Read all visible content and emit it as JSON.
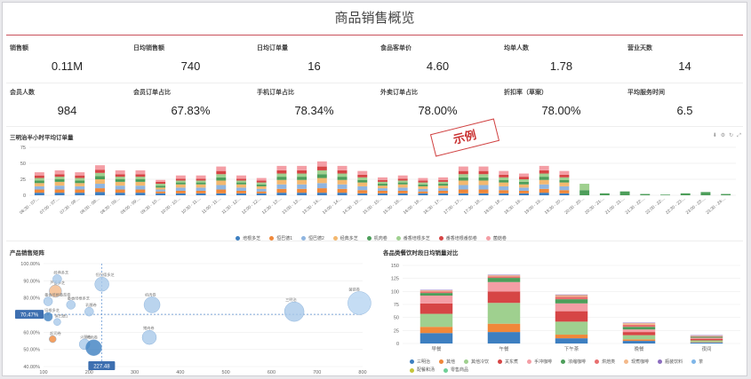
{
  "page_title": "商品销售概览",
  "stamp_text": "示例",
  "kpis": [
    {
      "label": "销售额",
      "value": "0.11M"
    },
    {
      "label": "日均销售额",
      "value": "740"
    },
    {
      "label": "日均订单量",
      "value": "16"
    },
    {
      "label": "食品客单价",
      "value": "4.60"
    },
    {
      "label": "均单人数",
      "value": "1.78"
    },
    {
      "label": "营业天数",
      "value": "14"
    },
    {
      "label": "会员人数",
      "value": "984"
    },
    {
      "label": "会员订单占比",
      "value": "67.83%"
    },
    {
      "label": "手机订单占比",
      "value": "78.34%"
    },
    {
      "label": "外卖订单占比",
      "value": "78.00%"
    },
    {
      "label": "折扣率（草案）",
      "value": "78.00%"
    },
    {
      "label": "平均服务时间",
      "value": "6.5"
    }
  ],
  "chart_icons": [
    "download-icon",
    "settings-icon",
    "refresh-icon",
    "expand-icon"
  ],
  "chart_data": [
    {
      "type": "bar",
      "title": "三明治半小时平均订单量",
      "ylim": [
        0,
        75
      ],
      "yticks": [
        0,
        25,
        50,
        75
      ],
      "grid": true,
      "legend_position": "bottom",
      "categories": [
        "06:30 - 07:...",
        "07:00 - 07:...",
        "07:30 - 08:...",
        "08:00 - 08:...",
        "08:30 - 09:...",
        "09:00 - 09:...",
        "09:30 - 10:...",
        "10:00 - 10:...",
        "10:30 - 11:...",
        "11:00 - 11:...",
        "11:30 - 12:...",
        "12:00 - 12:...",
        "12:30 - 13:...",
        "13:00 - 13:...",
        "13:30 - 14:...",
        "14:00 - 14:...",
        "14:30 - 15:...",
        "15:00 - 15:...",
        "15:30 - 16:...",
        "16:00 - 16:...",
        "16:30 - 17:...",
        "17:00 - 17:...",
        "17:30 - 18:...",
        "18:00 - 18:...",
        "18:30 - 19:...",
        "19:00 - 19:...",
        "19:30 - 20:...",
        "20:00 - 20:...",
        "20:30 - 21:...",
        "21:00 - 21:...",
        "21:30 - 22:...",
        "22:00 - 22:...",
        "22:30 - 23:...",
        "23:00 - 23:...",
        "23:30 - 24:..."
      ],
      "series": [
        {
          "name": "培根多芝",
          "color": "#3d7fc1",
          "values": [
            4,
            4,
            4,
            5,
            4,
            4,
            3,
            3,
            3,
            3,
            3,
            3,
            4,
            4,
            4,
            4,
            3,
            3,
            3,
            3,
            3,
            3,
            3,
            3,
            3,
            4,
            3,
            0,
            0,
            0,
            0,
            0,
            0,
            0,
            0
          ]
        },
        {
          "name": "恒巴德1",
          "color": "#f0883a",
          "values": [
            5,
            5,
            5,
            6,
            5,
            5,
            3,
            4,
            4,
            6,
            4,
            3,
            6,
            6,
            7,
            6,
            5,
            4,
            4,
            3,
            4,
            6,
            6,
            5,
            4,
            6,
            5,
            0,
            0,
            0,
            0,
            0,
            0,
            0,
            0
          ]
        },
        {
          "name": "恒巴德2",
          "color": "#8fb5e0",
          "values": [
            5,
            6,
            5,
            7,
            6,
            6,
            3,
            5,
            5,
            7,
            5,
            4,
            7,
            7,
            8,
            7,
            6,
            4,
            5,
            4,
            4,
            7,
            7,
            6,
            5,
            7,
            6,
            0,
            0,
            0,
            0,
            0,
            0,
            0,
            0
          ]
        },
        {
          "name": "经典多芝",
          "color": "#f3b86f",
          "values": [
            5,
            6,
            5,
            7,
            6,
            6,
            3,
            5,
            5,
            7,
            5,
            4,
            7,
            7,
            8,
            7,
            6,
            4,
            5,
            4,
            4,
            7,
            7,
            6,
            5,
            7,
            6,
            0,
            0,
            0,
            0,
            0,
            0,
            0,
            0
          ]
        },
        {
          "name": "机肉卷",
          "color": "#4d9e5a",
          "values": [
            4,
            4,
            4,
            5,
            4,
            4,
            3,
            3,
            3,
            5,
            3,
            3,
            5,
            5,
            6,
            5,
            4,
            3,
            3,
            3,
            3,
            5,
            5,
            4,
            4,
            5,
            4,
            8,
            3,
            6,
            2,
            1,
            3,
            5,
            2
          ]
        },
        {
          "name": "番香培根多芝",
          "color": "#9fd08f",
          "values": [
            4,
            4,
            4,
            5,
            4,
            4,
            3,
            3,
            3,
            5,
            3,
            3,
            5,
            5,
            6,
            5,
            4,
            3,
            3,
            3,
            3,
            5,
            5,
            4,
            4,
            5,
            4,
            10,
            0,
            0,
            0,
            0,
            0,
            0,
            0
          ]
        },
        {
          "name": "番香培根番茄卷",
          "color": "#d64545",
          "values": [
            4,
            4,
            4,
            5,
            4,
            4,
            3,
            3,
            3,
            5,
            3,
            3,
            5,
            5,
            6,
            5,
            4,
            3,
            3,
            3,
            3,
            5,
            5,
            4,
            4,
            5,
            4,
            0,
            0,
            0,
            0,
            0,
            0,
            0,
            0
          ]
        },
        {
          "name": "菌菇卷",
          "color": "#f49ea5",
          "values": [
            5,
            6,
            5,
            7,
            6,
            6,
            3,
            5,
            5,
            7,
            5,
            4,
            7,
            7,
            8,
            7,
            6,
            4,
            5,
            4,
            4,
            7,
            7,
            6,
            5,
            7,
            6,
            0,
            0,
            0,
            0,
            0,
            0,
            0,
            0
          ]
        }
      ]
    },
    {
      "type": "scatter",
      "title": "产品销售矩阵",
      "xlim": [
        100,
        800
      ],
      "ylim": [
        40,
        100
      ],
      "xticks": [
        100,
        200,
        300,
        400,
        500,
        600,
        700,
        800
      ],
      "yticks": [
        "40.00%",
        "50.00%",
        "60.00%",
        "70.00%",
        "80.00%",
        "90.00%",
        "100.00%"
      ],
      "ref_x_label": "227.48",
      "ref_y_label": "70.47%",
      "points": [
        {
          "label": "芦荟多芝",
          "x": 126,
          "y": 84,
          "r": 7,
          "color": "#f3b98a"
        },
        {
          "label": "恒巴德多芝",
          "x": 228,
          "y": 88,
          "r": 8,
          "color": "#a9c9ea"
        },
        {
          "label": "经典多芝",
          "x": 130,
          "y": 91,
          "r": 5,
          "color": "#a9c9ea"
        },
        {
          "label": "番香培根番茄卷",
          "x": 110,
          "y": 78,
          "r": 5,
          "color": "#a9c9ea"
        },
        {
          "label": "番香培根多芝",
          "x": 160,
          "y": 76,
          "r": 5,
          "color": "#a9c9ea"
        },
        {
          "label": "乳酪卷",
          "x": 200,
          "y": 72,
          "r": 5,
          "color": "#a9c9ea"
        },
        {
          "label": "机肉卷",
          "x": 338,
          "y": 76,
          "r": 9,
          "color": "#a9c9ea"
        },
        {
          "label": "三明治",
          "x": 650,
          "y": 72,
          "r": 11,
          "color": "#a9c9ea"
        },
        {
          "label": "菌菇卷",
          "x": 793,
          "y": 77,
          "r": 13,
          "color": "#b7d4f1"
        },
        {
          "label": "培根多芝",
          "x": 110,
          "y": 69,
          "r": 5,
          "color": "#3d7fc1"
        },
        {
          "label": "恒巴德1",
          "x": 130,
          "y": 66,
          "r": 4,
          "color": "#a9c9ea"
        },
        {
          "label": "起司卷",
          "x": 120,
          "y": 56,
          "r": 4,
          "color": "#f0883a"
        },
        {
          "label": "火腿卷",
          "x": 190,
          "y": 53,
          "r": 6,
          "color": "#a9c9ea"
        },
        {
          "label": "鸡肉卷",
          "x": 210,
          "y": 51,
          "r": 9,
          "color": "#3d7fc1"
        },
        {
          "label": "猪肉卷",
          "x": 332,
          "y": 57,
          "r": 8,
          "color": "#a9c9ea"
        }
      ]
    },
    {
      "type": "bar",
      "title": "各品类餐饮时段日均销量对比",
      "ylim": [
        0,
        150
      ],
      "yticks": [
        0,
        25,
        50,
        75,
        100,
        125,
        150
      ],
      "grid": true,
      "legend_position": "bottom",
      "categories": [
        "早餐",
        "午餐",
        "下午茶",
        "晚餐",
        "夜间"
      ],
      "series": [
        {
          "name": "三明治",
          "color": "#3d7fc1",
          "values": [
            20,
            22,
            10,
            5,
            2
          ]
        },
        {
          "name": "其他",
          "color": "#f0883a",
          "values": [
            12,
            16,
            7,
            3,
            1
          ]
        },
        {
          "name": "其他冷饮",
          "color": "#9fd08f",
          "values": [
            25,
            40,
            25,
            8,
            3
          ]
        },
        {
          "name": "关东煮",
          "color": "#d64545",
          "values": [
            20,
            22,
            20,
            6,
            3
          ]
        },
        {
          "name": "手冲咖啡",
          "color": "#f49ea5",
          "values": [
            15,
            18,
            15,
            5,
            2
          ]
        },
        {
          "name": "浓缩咖啡",
          "color": "#4d9e5a",
          "values": [
            5,
            8,
            8,
            5,
            2
          ]
        },
        {
          "name": "烘焙类",
          "color": "#e86f6f",
          "values": [
            3,
            3,
            5,
            4,
            1
          ]
        },
        {
          "name": "现煮咖啡",
          "color": "#f3b98a",
          "values": [
            2,
            2,
            3,
            3,
            1
          ]
        },
        {
          "name": "瓶装饮料",
          "color": "#8c6dbf",
          "values": [
            1,
            1,
            1,
            1,
            1
          ]
        },
        {
          "name": "茶",
          "color": "#7fb6e8",
          "values": [
            0,
            0,
            0,
            0,
            0
          ]
        },
        {
          "name": "配餐和汤",
          "color": "#c4c53a",
          "values": [
            0,
            0,
            0,
            0,
            0
          ]
        },
        {
          "name": "零售商品",
          "color": "#6fcf97",
          "values": [
            0,
            0,
            0,
            0,
            0
          ]
        }
      ]
    }
  ]
}
